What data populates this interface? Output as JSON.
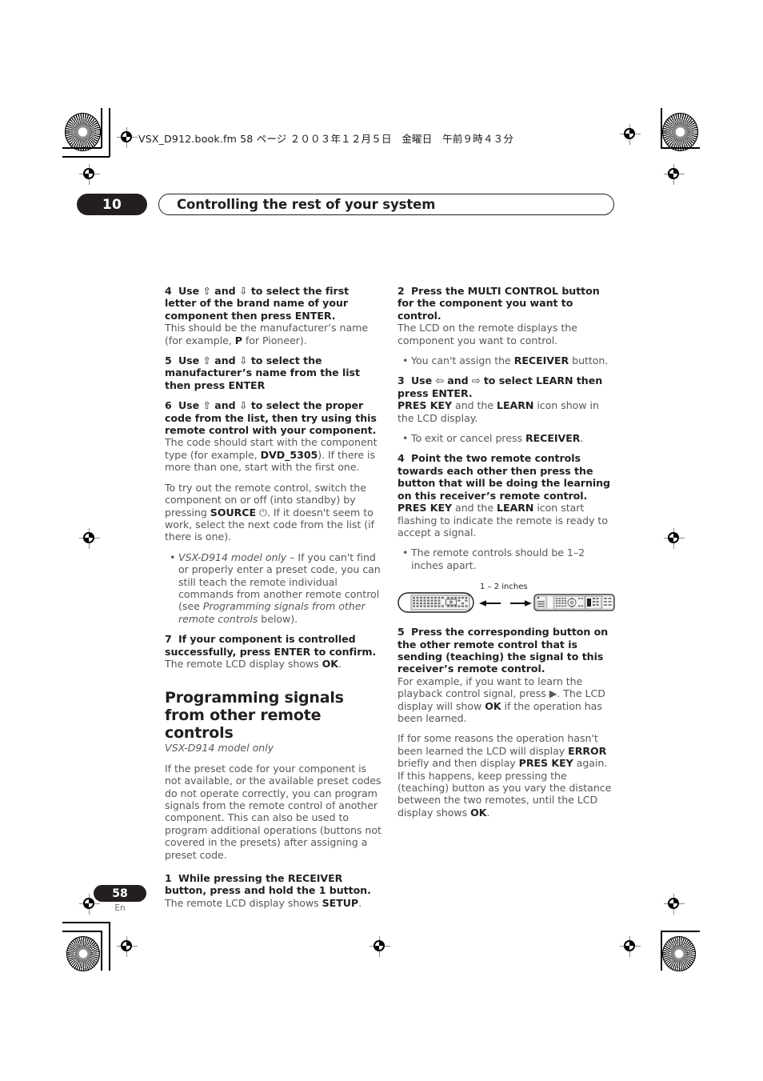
{
  "header": {
    "file_info": "VSX_D912.book.fm  58 ページ  ２００３年１２月５日　金曜日　午前９時４３分",
    "chapter_number": "10",
    "chapter_title": "Controlling the rest of your system"
  },
  "footer": {
    "page_number": "58",
    "language_code": "En"
  },
  "left_column": {
    "step4": {
      "num": "4",
      "heading_part1": "Use ",
      "arrow_up": "⇧",
      "heading_part2": " and ",
      "arrow_down": "⇩",
      "heading_part3": " to select the first letter of the brand name of your component then press ENTER.",
      "body_part1": "This should be the manufacturer’s name (for example, ",
      "body_bold": "P",
      "body_part2": " for Pioneer)."
    },
    "step5": {
      "num": "5",
      "heading_part1": "Use ",
      "arrow_up": "⇧",
      "heading_part2": " and ",
      "arrow_down": "⇩",
      "heading_part3": " to select the manufacturer’s name from the list then press ENTER"
    },
    "step6": {
      "num": "6",
      "heading_part1": "Use ",
      "arrow_up": "⇧",
      "heading_part2": " and ",
      "arrow_down": "⇩",
      "heading_part3": " to select the proper code from the list, then try using this remote control with your component.",
      "body1_part1": "The code should start with the component type (for example, ",
      "body1_bold": "DVD_5305",
      "body1_part2": "). If there is more than one, start with the first one.",
      "body2_part1": "To try out the remote control, switch the component on or off (into standby) by pressing ",
      "body2_bold": "SOURCE",
      "body2_symbol": "⏻",
      "body2_part2": ". If it doesn't seem to work, select the next code from the list (if there is one).",
      "bullet_italic": "VSX-D914 model only",
      "bullet_part1": " – If you can't find or properly enter a preset code, you can still teach the remote individual commands from another remote control (see ",
      "bullet_italic2": "Programming signals from other remote controls",
      "bullet_part2": " below)."
    },
    "step7": {
      "num": "7",
      "heading": "If your component is controlled successfully, press ENTER to confirm.",
      "body_part1": "The remote LCD display shows ",
      "body_bold": "OK",
      "body_part2": "."
    },
    "section": {
      "heading": "Programming signals from other remote controls",
      "subheading": "VSX-D914 model only",
      "intro": "If the preset code for your component is not available, or the available preset codes do not operate correctly, you can program signals from the remote control of another component. This can also be used to program additional operations (buttons not covered in the presets) after assigning a preset code."
    },
    "step1": {
      "num": "1",
      "heading": "While pressing the RECEIVER button, press and hold the 1 button.",
      "body_part1": "The remote LCD display shows ",
      "body_bold": "SETUP",
      "body_part2": "."
    }
  },
  "right_column": {
    "step2": {
      "num": "2",
      "heading": "Press the MULTI CONTROL button for the component you want to control.",
      "body": "The LCD on the remote displays the component you want to control.",
      "bullet_part1": "You can't assign the ",
      "bullet_bold": "RECEIVER",
      "bullet_part2": " button."
    },
    "step3": {
      "num": "3",
      "heading_part1": "Use ",
      "arrow_left": "⇦",
      "heading_part2": " and ",
      "arrow_right": "⇨",
      "heading_part3": " to select LEARN then press ENTER.",
      "body_bold1": "PRES KEY",
      "body_part1": " and the ",
      "body_bold2": "LEARN",
      "body_part2": " icon show in the LCD display.",
      "bullet_part1": "To exit or cancel press ",
      "bullet_bold": "RECEIVER",
      "bullet_part2": "."
    },
    "step4": {
      "num": "4",
      "heading": "Point the two remote controls towards each other then press the button that will be doing the learning on this receiver’s remote control.",
      "body_bold1": "PRES KEY",
      "body_part1": " and the ",
      "body_bold2": "LEARN",
      "body_part2": " icon start flashing to indicate the remote is ready to accept a signal.",
      "bullet": "The remote controls should be 1–2 inches apart."
    },
    "figure": {
      "distance_label": "1 – 2 inches",
      "left_remote_name": "remote-control-left",
      "right_remote_name": "remote-control-right"
    },
    "step5": {
      "num": "5",
      "heading": "Press the corresponding button on the other remote control that is sending (teaching) the signal to this receiver’s remote control.",
      "body1_part1": "For example, if you want to learn the playback control signal, press ",
      "body1_symbol": "▶",
      "body1_part2": ". The LCD display will show ",
      "body1_bold": "OK",
      "body1_part3": " if the operation has been learned.",
      "body2_part1": "If for some reasons the operation hasn't been learned the LCD will display ",
      "body2_bold1": "ERROR",
      "body2_part2": " briefly and then display ",
      "body2_bold2": "PRES KEY",
      "body2_part3": " again. If this happens, keep pressing the (teaching) button as you vary the distance between the two remotes, until the LCD display shows ",
      "body2_bold3": "OK",
      "body2_part4": "."
    }
  }
}
